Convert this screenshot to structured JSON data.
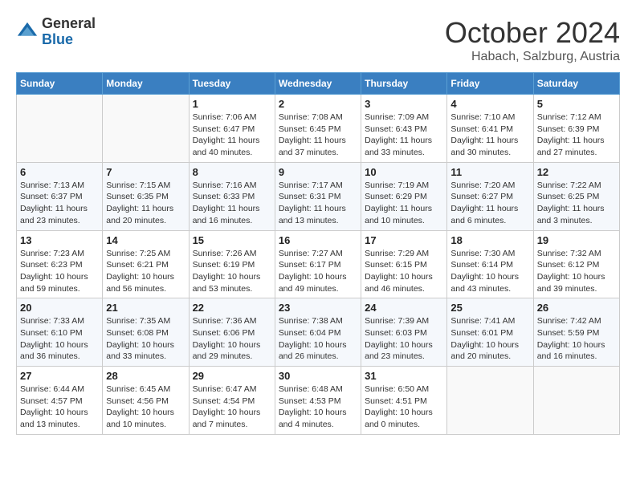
{
  "header": {
    "logo": {
      "line1": "General",
      "line2": "Blue"
    },
    "title": "October 2024",
    "location": "Habach, Salzburg, Austria"
  },
  "weekdays": [
    "Sunday",
    "Monday",
    "Tuesday",
    "Wednesday",
    "Thursday",
    "Friday",
    "Saturday"
  ],
  "weeks": [
    [
      {
        "day": "",
        "sunrise": "",
        "sunset": "",
        "daylight": ""
      },
      {
        "day": "",
        "sunrise": "",
        "sunset": "",
        "daylight": ""
      },
      {
        "day": "1",
        "sunrise": "Sunrise: 7:06 AM",
        "sunset": "Sunset: 6:47 PM",
        "daylight": "Daylight: 11 hours and 40 minutes."
      },
      {
        "day": "2",
        "sunrise": "Sunrise: 7:08 AM",
        "sunset": "Sunset: 6:45 PM",
        "daylight": "Daylight: 11 hours and 37 minutes."
      },
      {
        "day": "3",
        "sunrise": "Sunrise: 7:09 AM",
        "sunset": "Sunset: 6:43 PM",
        "daylight": "Daylight: 11 hours and 33 minutes."
      },
      {
        "day": "4",
        "sunrise": "Sunrise: 7:10 AM",
        "sunset": "Sunset: 6:41 PM",
        "daylight": "Daylight: 11 hours and 30 minutes."
      },
      {
        "day": "5",
        "sunrise": "Sunrise: 7:12 AM",
        "sunset": "Sunset: 6:39 PM",
        "daylight": "Daylight: 11 hours and 27 minutes."
      }
    ],
    [
      {
        "day": "6",
        "sunrise": "Sunrise: 7:13 AM",
        "sunset": "Sunset: 6:37 PM",
        "daylight": "Daylight: 11 hours and 23 minutes."
      },
      {
        "day": "7",
        "sunrise": "Sunrise: 7:15 AM",
        "sunset": "Sunset: 6:35 PM",
        "daylight": "Daylight: 11 hours and 20 minutes."
      },
      {
        "day": "8",
        "sunrise": "Sunrise: 7:16 AM",
        "sunset": "Sunset: 6:33 PM",
        "daylight": "Daylight: 11 hours and 16 minutes."
      },
      {
        "day": "9",
        "sunrise": "Sunrise: 7:17 AM",
        "sunset": "Sunset: 6:31 PM",
        "daylight": "Daylight: 11 hours and 13 minutes."
      },
      {
        "day": "10",
        "sunrise": "Sunrise: 7:19 AM",
        "sunset": "Sunset: 6:29 PM",
        "daylight": "Daylight: 11 hours and 10 minutes."
      },
      {
        "day": "11",
        "sunrise": "Sunrise: 7:20 AM",
        "sunset": "Sunset: 6:27 PM",
        "daylight": "Daylight: 11 hours and 6 minutes."
      },
      {
        "day": "12",
        "sunrise": "Sunrise: 7:22 AM",
        "sunset": "Sunset: 6:25 PM",
        "daylight": "Daylight: 11 hours and 3 minutes."
      }
    ],
    [
      {
        "day": "13",
        "sunrise": "Sunrise: 7:23 AM",
        "sunset": "Sunset: 6:23 PM",
        "daylight": "Daylight: 10 hours and 59 minutes."
      },
      {
        "day": "14",
        "sunrise": "Sunrise: 7:25 AM",
        "sunset": "Sunset: 6:21 PM",
        "daylight": "Daylight: 10 hours and 56 minutes."
      },
      {
        "day": "15",
        "sunrise": "Sunrise: 7:26 AM",
        "sunset": "Sunset: 6:19 PM",
        "daylight": "Daylight: 10 hours and 53 minutes."
      },
      {
        "day": "16",
        "sunrise": "Sunrise: 7:27 AM",
        "sunset": "Sunset: 6:17 PM",
        "daylight": "Daylight: 10 hours and 49 minutes."
      },
      {
        "day": "17",
        "sunrise": "Sunrise: 7:29 AM",
        "sunset": "Sunset: 6:15 PM",
        "daylight": "Daylight: 10 hours and 46 minutes."
      },
      {
        "day": "18",
        "sunrise": "Sunrise: 7:30 AM",
        "sunset": "Sunset: 6:14 PM",
        "daylight": "Daylight: 10 hours and 43 minutes."
      },
      {
        "day": "19",
        "sunrise": "Sunrise: 7:32 AM",
        "sunset": "Sunset: 6:12 PM",
        "daylight": "Daylight: 10 hours and 39 minutes."
      }
    ],
    [
      {
        "day": "20",
        "sunrise": "Sunrise: 7:33 AM",
        "sunset": "Sunset: 6:10 PM",
        "daylight": "Daylight: 10 hours and 36 minutes."
      },
      {
        "day": "21",
        "sunrise": "Sunrise: 7:35 AM",
        "sunset": "Sunset: 6:08 PM",
        "daylight": "Daylight: 10 hours and 33 minutes."
      },
      {
        "day": "22",
        "sunrise": "Sunrise: 7:36 AM",
        "sunset": "Sunset: 6:06 PM",
        "daylight": "Daylight: 10 hours and 29 minutes."
      },
      {
        "day": "23",
        "sunrise": "Sunrise: 7:38 AM",
        "sunset": "Sunset: 6:04 PM",
        "daylight": "Daylight: 10 hours and 26 minutes."
      },
      {
        "day": "24",
        "sunrise": "Sunrise: 7:39 AM",
        "sunset": "Sunset: 6:03 PM",
        "daylight": "Daylight: 10 hours and 23 minutes."
      },
      {
        "day": "25",
        "sunrise": "Sunrise: 7:41 AM",
        "sunset": "Sunset: 6:01 PM",
        "daylight": "Daylight: 10 hours and 20 minutes."
      },
      {
        "day": "26",
        "sunrise": "Sunrise: 7:42 AM",
        "sunset": "Sunset: 5:59 PM",
        "daylight": "Daylight: 10 hours and 16 minutes."
      }
    ],
    [
      {
        "day": "27",
        "sunrise": "Sunrise: 6:44 AM",
        "sunset": "Sunset: 4:57 PM",
        "daylight": "Daylight: 10 hours and 13 minutes."
      },
      {
        "day": "28",
        "sunrise": "Sunrise: 6:45 AM",
        "sunset": "Sunset: 4:56 PM",
        "daylight": "Daylight: 10 hours and 10 minutes."
      },
      {
        "day": "29",
        "sunrise": "Sunrise: 6:47 AM",
        "sunset": "Sunset: 4:54 PM",
        "daylight": "Daylight: 10 hours and 7 minutes."
      },
      {
        "day": "30",
        "sunrise": "Sunrise: 6:48 AM",
        "sunset": "Sunset: 4:53 PM",
        "daylight": "Daylight: 10 hours and 4 minutes."
      },
      {
        "day": "31",
        "sunrise": "Sunrise: 6:50 AM",
        "sunset": "Sunset: 4:51 PM",
        "daylight": "Daylight: 10 hours and 0 minutes."
      },
      {
        "day": "",
        "sunrise": "",
        "sunset": "",
        "daylight": ""
      },
      {
        "day": "",
        "sunrise": "",
        "sunset": "",
        "daylight": ""
      }
    ]
  ]
}
